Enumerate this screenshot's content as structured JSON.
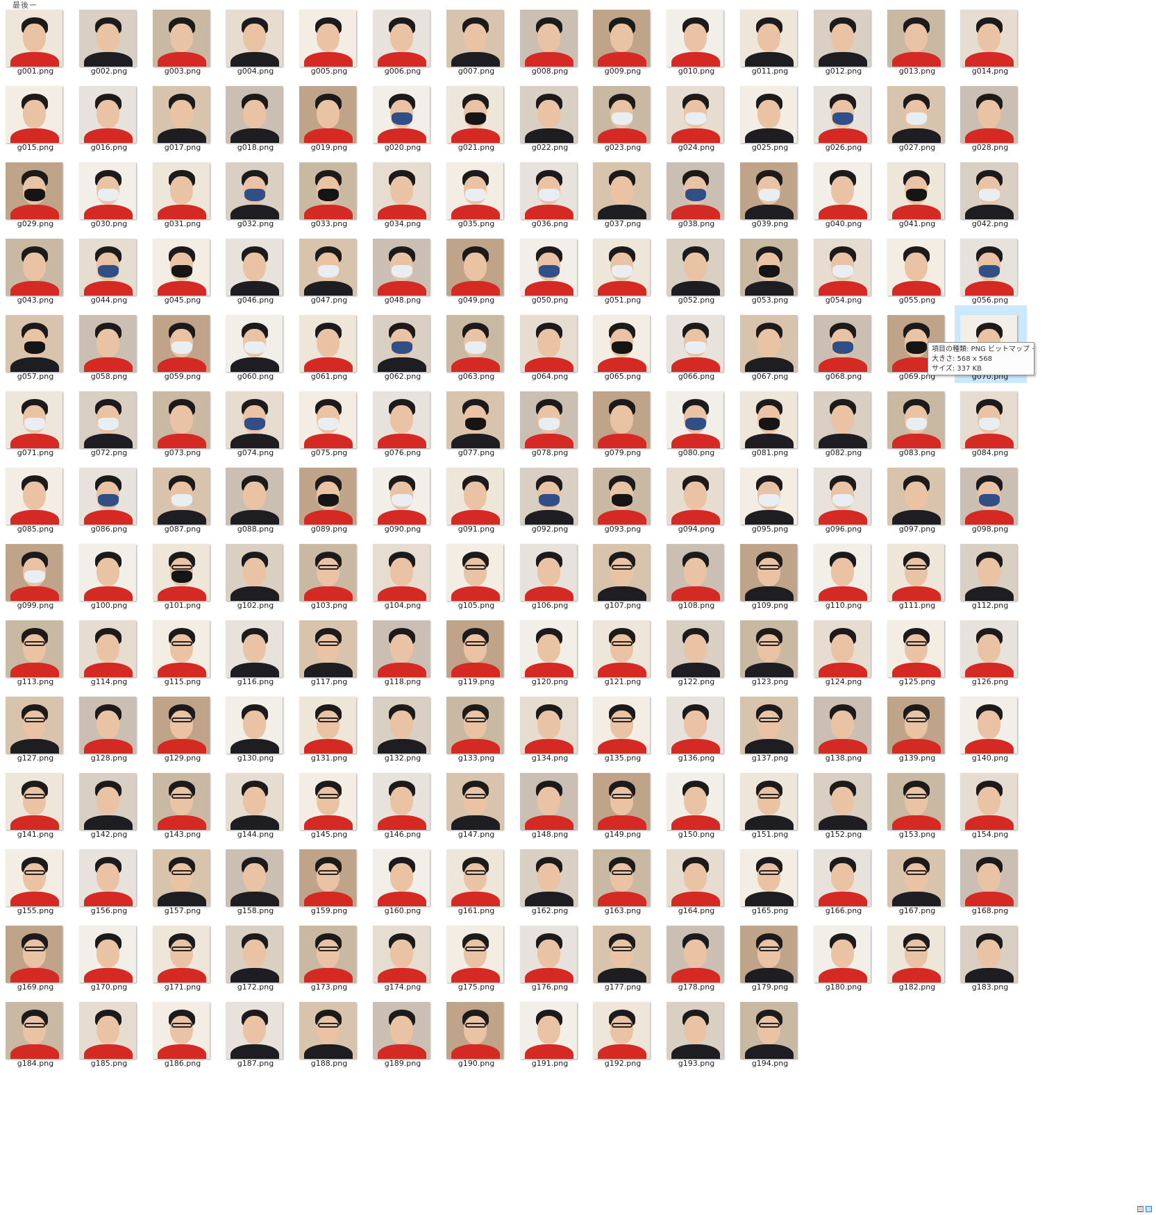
{
  "window": {
    "top_label": "最後ー"
  },
  "grid": {
    "selected_item": "g070.png",
    "items": [
      "g001.png",
      "g002.png",
      "g003.png",
      "g004.png",
      "g005.png",
      "g006.png",
      "g007.png",
      "g008.png",
      "g009.png",
      "g010.png",
      "g011.png",
      "g012.png",
      "g013.png",
      "g014.png",
      "g015.png",
      "g016.png",
      "g017.png",
      "g018.png",
      "g019.png",
      "g020.png",
      "g021.png",
      "g022.png",
      "g023.png",
      "g024.png",
      "g025.png",
      "g026.png",
      "g027.png",
      "g028.png",
      "g029.png",
      "g030.png",
      "g031.png",
      "g032.png",
      "g033.png",
      "g034.png",
      "g035.png",
      "g036.png",
      "g037.png",
      "g038.png",
      "g039.png",
      "g040.png",
      "g041.png",
      "g042.png",
      "g043.png",
      "g044.png",
      "g045.png",
      "g046.png",
      "g047.png",
      "g048.png",
      "g049.png",
      "g050.png",
      "g051.png",
      "g052.png",
      "g053.png",
      "g054.png",
      "g055.png",
      "g056.png",
      "g057.png",
      "g058.png",
      "g059.png",
      "g060.png",
      "g061.png",
      "g062.png",
      "g063.png",
      "g064.png",
      "g065.png",
      "g066.png",
      "g067.png",
      "g068.png",
      "g069.png",
      "g070.png",
      "g071.png",
      "g072.png",
      "g073.png",
      "g074.png",
      "g075.png",
      "g076.png",
      "g077.png",
      "g078.png",
      "g079.png",
      "g080.png",
      "g081.png",
      "g082.png",
      "g083.png",
      "g084.png",
      "g085.png",
      "g086.png",
      "g087.png",
      "g088.png",
      "g089.png",
      "g090.png",
      "g091.png",
      "g092.png",
      "g093.png",
      "g094.png",
      "g095.png",
      "g096.png",
      "g097.png",
      "g098.png",
      "g099.png",
      "g100.png",
      "g101.png",
      "g102.png",
      "g103.png",
      "g104.png",
      "g105.png",
      "g106.png",
      "g107.png",
      "g108.png",
      "g109.png",
      "g110.png",
      "g111.png",
      "g112.png",
      "g113.png",
      "g114.png",
      "g115.png",
      "g116.png",
      "g117.png",
      "g118.png",
      "g119.png",
      "g120.png",
      "g121.png",
      "g122.png",
      "g123.png",
      "g124.png",
      "g125.png",
      "g126.png",
      "g127.png",
      "g128.png",
      "g129.png",
      "g130.png",
      "g131.png",
      "g132.png",
      "g133.png",
      "g134.png",
      "g135.png",
      "g136.png",
      "g137.png",
      "g138.png",
      "g139.png",
      "g140.png",
      "g141.png",
      "g142.png",
      "g143.png",
      "g144.png",
      "g145.png",
      "g146.png",
      "g147.png",
      "g148.png",
      "g149.png",
      "g150.png",
      "g151.png",
      "g152.png",
      "g153.png",
      "g154.png",
      "g155.png",
      "g156.png",
      "g157.png",
      "g158.png",
      "g159.png",
      "g160.png",
      "g161.png",
      "g162.png",
      "g163.png",
      "g164.png",
      "g165.png",
      "g166.png",
      "g167.png",
      "g168.png",
      "g169.png",
      "g170.png",
      "g171.png",
      "g172.png",
      "g173.png",
      "g174.png",
      "g175.png",
      "g176.png",
      "g177.png",
      "g178.png",
      "g179.png",
      "g180.png",
      "g182.png",
      "g183.png",
      "g184.png",
      "g185.png",
      "g186.png",
      "g187.png",
      "g188.png",
      "g189.png",
      "g190.png",
      "g191.png",
      "g192.png",
      "g193.png",
      "g194.png"
    ]
  },
  "tooltip": {
    "type_line": "項目の種類: PNG ビットマップ イメー",
    "size_line": "大きさ: 568 x 568",
    "filesize_line": "サイズ: 337 KB"
  },
  "colors": {
    "selection": "#cce8ff",
    "shirt_red": "#d42a23",
    "shirt_black": "#1e1e22",
    "mask_white": "#e8eef2",
    "mask_blue": "#2f4f86",
    "mask_black": "#151515"
  }
}
